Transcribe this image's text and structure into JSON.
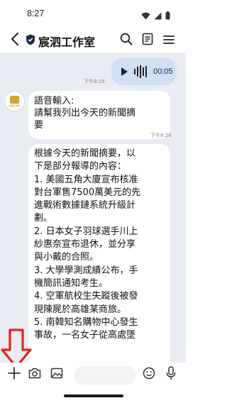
{
  "status_bar": {
    "time": "8:27",
    "icons": [
      "wifi-icon",
      "signal-icon",
      "battery-icon"
    ]
  },
  "header": {
    "title": "宸泗工作室",
    "icons": [
      "back-arrow-icon",
      "shield-icon",
      "search-icon",
      "notes-icon",
      "menu-icon"
    ]
  },
  "messages": {
    "voice": {
      "duration": "00:05",
      "time": "下午8:26"
    },
    "sender": {
      "avatar_text": "宸泗工作室"
    },
    "reply1": {
      "lines": [
        "語音輸入:",
        "請幫我列出今天的新聞摘",
        "要"
      ],
      "time": "下午8:26"
    },
    "reply2": {
      "lines": [
        "根據今天的新聞摘要，以",
        "下是部分報導的內容：",
        "1. 美國五角大廈宣布核准",
        "對台軍售7500萬美元的先",
        "進戰術數據鏈系統升級計",
        "劃。",
        "2. 日本女子羽球選手川上",
        "紗惠奈宣布退休，並分享",
        "與小戴的合照。",
        "3. 大學學測成績公布，手",
        "機簡訊通知考生。",
        "4. 空軍航校生失蹤後被發",
        "現陳屍於高雄某商旅。",
        "5. 南韓知名購物中心發生",
        "事故，一名女子從高處墜"
      ]
    }
  },
  "input_bar": {
    "placeholder": "",
    "icons": [
      "plus-icon",
      "camera-icon",
      "image-icon",
      "emoji-icon",
      "microphone-icon"
    ]
  },
  "colors": {
    "chat_background": "#e9ecf2",
    "outgoing_bubble": "#cfe0f5",
    "incoming_bubble": "#ffffff",
    "annotation_arrow": "#e52222"
  }
}
